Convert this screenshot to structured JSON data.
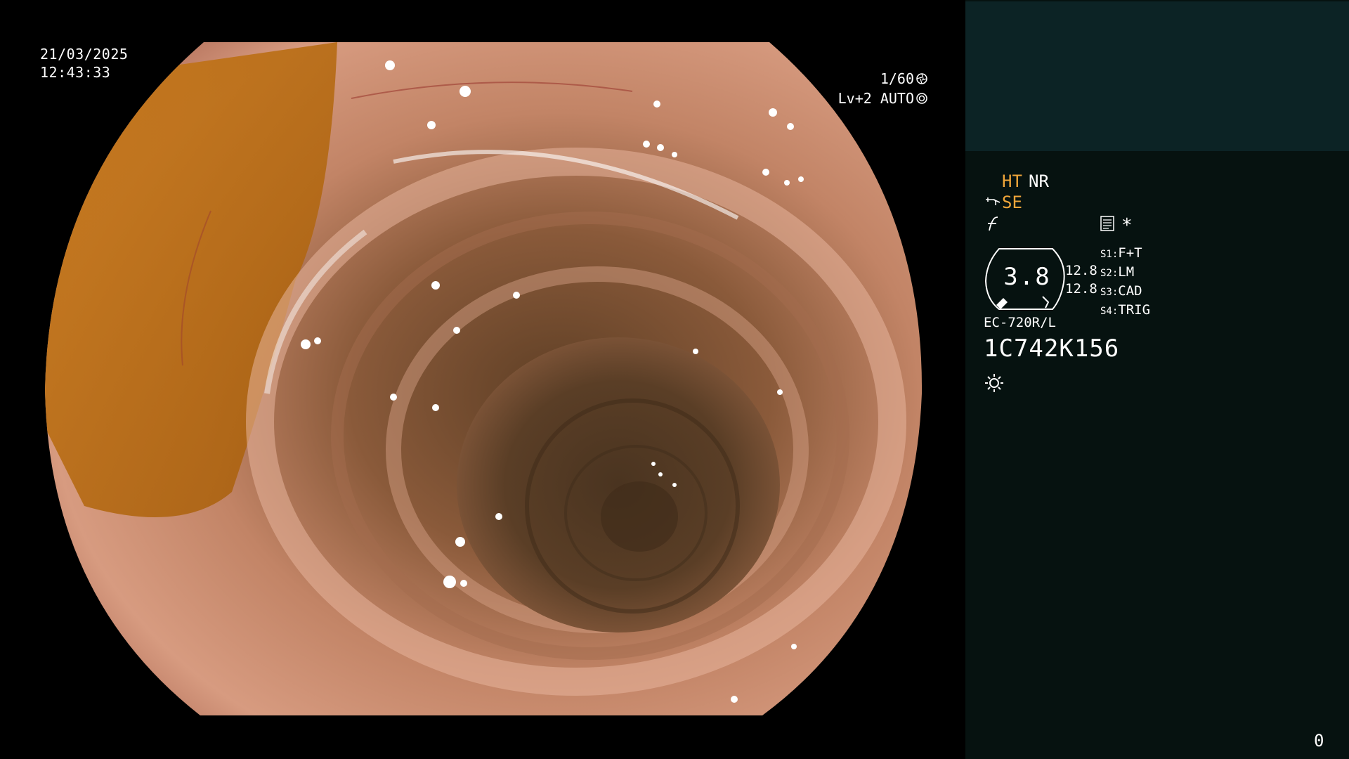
{
  "overlay": {
    "date": "21/03/2025",
    "time": "12:43:33",
    "shutter": "1/60",
    "shutter_icon": "aperture-icon",
    "level": "Lv+2 AUTO",
    "level_icon": "iris-icon"
  },
  "panel": {
    "ht_label": "HT",
    "nr_label": "NR",
    "se_label": "SE",
    "star": "*",
    "gauge_value": "3.8",
    "values": [
      "12.8",
      "12.8"
    ],
    "switches": [
      {
        "key": "S1:",
        "value": "F+T"
      },
      {
        "key": "S2:",
        "value": "LM"
      },
      {
        "key": "S3:",
        "value": "CAD"
      },
      {
        "key": "S4:",
        "value": "TRIG"
      }
    ],
    "model": "EC-720R/L",
    "serial": "1C742K156",
    "page_number": "0",
    "colors": {
      "accent_orange": "#f0a63a",
      "panel_bg": "#061210",
      "panel_top": "#0c2325"
    }
  }
}
